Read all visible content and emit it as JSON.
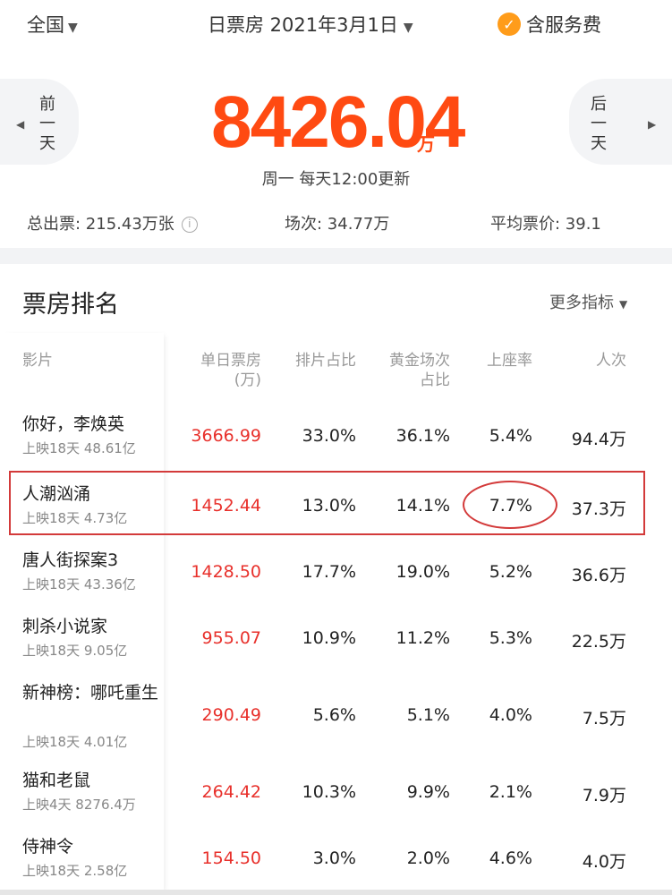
{
  "header": {
    "region": "全国",
    "date_label": "日票房 2021年3月1日",
    "service_fee": "含服务费"
  },
  "summary": {
    "prev_label": [
      "前",
      "一",
      "天"
    ],
    "next_label": [
      "后",
      "一",
      "天"
    ],
    "total": "8426.04",
    "total_unit": "万",
    "update_note": "周一 每天12:00更新",
    "tickets": "总出票: 215.43万张",
    "shows": "场次: 34.77万",
    "avg_price": "平均票价: 39.1"
  },
  "ranking": {
    "title": "票房排名",
    "more": "更多指标",
    "columns": {
      "film": "影片",
      "box_office": [
        "单日票房",
        "(万)"
      ],
      "screening_share": "排片占比",
      "golden_share": [
        "黄金场次",
        "占比"
      ],
      "occupancy": "上座率",
      "attendance": "人次"
    },
    "rows": [
      {
        "name": "你好，李焕英",
        "sub": "上映18天 48.61亿",
        "box": "3666.99",
        "share": "33.0%",
        "golden": "36.1%",
        "occ": "5.4%",
        "people": "94.4万"
      },
      {
        "name": "人潮汹涌",
        "sub": "上映18天 4.73亿",
        "box": "1452.44",
        "share": "13.0%",
        "golden": "14.1%",
        "occ": "7.7%",
        "people": "37.3万"
      },
      {
        "name": "唐人街探案3",
        "sub": "上映18天 43.36亿",
        "box": "1428.50",
        "share": "17.7%",
        "golden": "19.0%",
        "occ": "5.2%",
        "people": "36.6万"
      },
      {
        "name": "刺杀小说家",
        "sub": "上映18天 9.05亿",
        "box": "955.07",
        "share": "10.9%",
        "golden": "11.2%",
        "occ": "5.3%",
        "people": "22.5万"
      },
      {
        "name": "新神榜：哪吒重生",
        "sub": "上映18天 4.01亿",
        "box": "290.49",
        "share": "5.6%",
        "golden": "5.1%",
        "occ": "4.0%",
        "people": "7.5万"
      },
      {
        "name": "猫和老鼠",
        "sub": "上映4天 8276.4万",
        "box": "264.42",
        "share": "10.3%",
        "golden": "9.9%",
        "occ": "2.1%",
        "people": "7.9万"
      },
      {
        "name": "侍神令",
        "sub": "上映18天 2.58亿",
        "box": "154.50",
        "share": "3.0%",
        "golden": "2.0%",
        "occ": "4.6%",
        "people": "4.0万"
      }
    ]
  }
}
